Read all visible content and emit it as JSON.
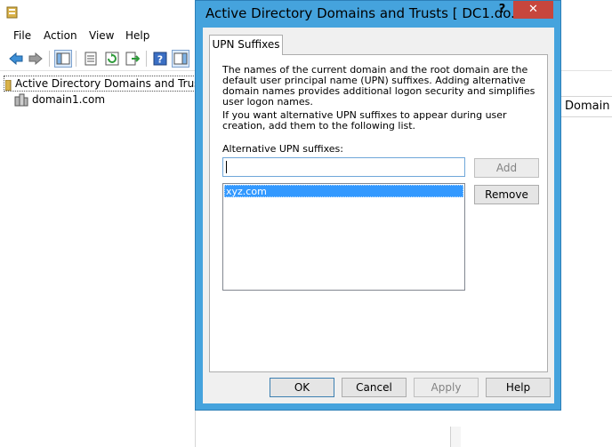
{
  "main_window": {
    "menu": [
      "File",
      "Action",
      "View",
      "Help"
    ],
    "tree": {
      "root_label": "Active Directory Domains and Trusts [",
      "items": [
        "domain1.com"
      ]
    },
    "column_header": "Domain"
  },
  "dialog": {
    "title": "Active Directory Domains and Trusts [ DC1.do...",
    "help_glyph": "?",
    "close_glyph": "✕",
    "tab_label": "UPN Suffixes",
    "description": "The names of the current domain and the root domain are the default user principal name (UPN) suffixes. Adding alternative domain names provides additional logon security and simplifies user logon names.",
    "instruction": "If you want alternative UPN suffixes to appear during user creation, add them to the following list.",
    "alt_label": "Alternative UPN suffixes:",
    "input_value": "",
    "add_label": "Add",
    "remove_label": "Remove",
    "suffixes": [
      "xyz.com"
    ],
    "buttons": {
      "ok": "OK",
      "cancel": "Cancel",
      "apply": "Apply",
      "help": "Help"
    }
  },
  "colors": {
    "dialog_frame": "#45a3dd",
    "close_button": "#c7463d",
    "selection": "#3399ff"
  }
}
